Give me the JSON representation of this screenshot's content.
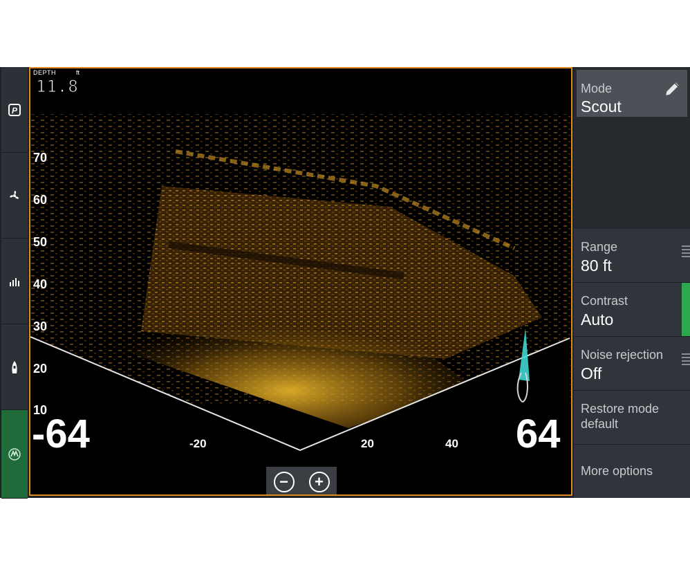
{
  "rail": {
    "items": [
      {
        "icon": "parking-icon"
      },
      {
        "icon": "propeller-icon"
      },
      {
        "icon": "signal-bars-icon"
      },
      {
        "icon": "boat-icon"
      },
      {
        "icon": "brand-logo-icon"
      }
    ]
  },
  "sonar": {
    "depth_label": "DEPTH",
    "depth_unit": "ft",
    "depth_value": "11.8",
    "left_range": "-64",
    "right_range": "64",
    "depth_ticks": [
      "70",
      "60",
      "50",
      "40",
      "30",
      "20",
      "10"
    ],
    "x_ticks": [
      "-20",
      "20",
      "40"
    ],
    "zoom_out": "−",
    "zoom_in": "+",
    "colors": {
      "frame": "#e08a1e",
      "echo": "#d9a01c"
    }
  },
  "menu": {
    "mode_label": "Mode",
    "mode_value": "Scout",
    "range_label": "Range",
    "range_value": "80 ft",
    "contrast_label": "Contrast",
    "contrast_value": "Auto",
    "noise_label": "Noise rejection",
    "noise_value": "Off",
    "restore_line1": "Restore mode",
    "restore_line2": "default",
    "more_options": "More options"
  }
}
